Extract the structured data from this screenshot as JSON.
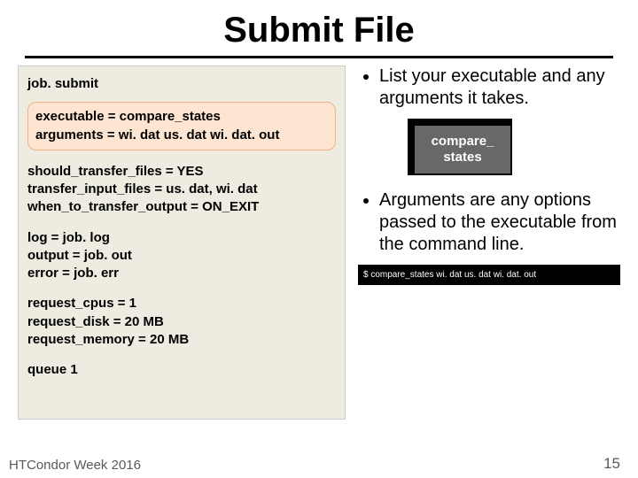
{
  "title": "Submit File",
  "file": {
    "header": "job. submit",
    "exec_line": "executable = compare_states",
    "args_line": "arguments = wi. dat us. dat wi. dat. out",
    "p1_l1": "should_transfer_files = YES",
    "p1_l2": "transfer_input_files = us. dat, wi. dat",
    "p1_l3": "when_to_transfer_output = ON_EXIT",
    "p2_l1": "log = job. log",
    "p2_l2": "output = job. out",
    "p2_l3": "error = job. err",
    "p3_l1": "request_cpus = 1",
    "p3_l2": "request_disk = 20 MB",
    "p3_l3": "request_memory = 20 MB",
    "queue": "queue 1"
  },
  "bullets": {
    "b1": "List your executable and any arguments it takes.",
    "b2": "Arguments are any options passed to the executable from the command line."
  },
  "box_label": "compare_\nstates",
  "cmdline": "$ compare_states wi. dat us. dat wi. dat. out",
  "footer_left": "HTCondor Week 2016",
  "footer_right": "15"
}
